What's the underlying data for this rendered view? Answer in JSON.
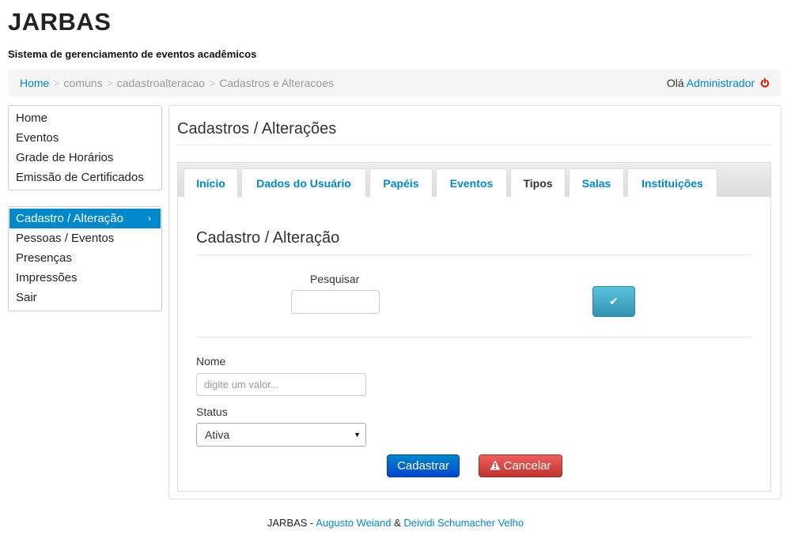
{
  "header": {
    "title": "JARBAS",
    "subtitle": "Sistema de gerenciamento de eventos acadêmicos"
  },
  "breadcrumb": {
    "items": [
      "Home",
      "comuns",
      "cadastroalteracao",
      "Cadastros e Alteracoes"
    ],
    "separator": ">"
  },
  "user": {
    "greeting": "Olá",
    "name": "Administrador",
    "logout_icon": "power-icon"
  },
  "sidebar": {
    "group1": [
      "Home",
      "Eventos",
      "Grade de Horários",
      "Emissão de Certificados"
    ],
    "group2": [
      "Cadastro / Alteração",
      "Pessoas / Eventos",
      "Presenças",
      "Impressões",
      "Sair"
    ],
    "active_item": "Cadastro / Alteração",
    "active_chevron": "›"
  },
  "main": {
    "title": "Cadastros / Alterações",
    "tabs": [
      "Início",
      "Dados do Usuário",
      "Papéis",
      "Eventos",
      "Tipos",
      "Salas",
      "Instituições"
    ],
    "active_tab": "Tipos"
  },
  "form": {
    "title": "Cadastro / Alteração",
    "search_label": "Pesquisar",
    "search_value": "",
    "confirm_icon": "✔",
    "nome_label": "Nome",
    "nome_placeholder": "digite um valor...",
    "status_label": "Status",
    "status_value": "Ativa",
    "submit_label": "Cadastrar",
    "cancel_label": "Cancelar"
  },
  "footer": {
    "prefix": "JARBAS -",
    "author1": "Augusto Weiand",
    "amp": "&",
    "author2": "Deividi Schumacher Velho"
  },
  "colors": {
    "link": "#0088cc",
    "primary": "#0044cc",
    "danger": "#bd362f",
    "info": "#2f96b4"
  }
}
